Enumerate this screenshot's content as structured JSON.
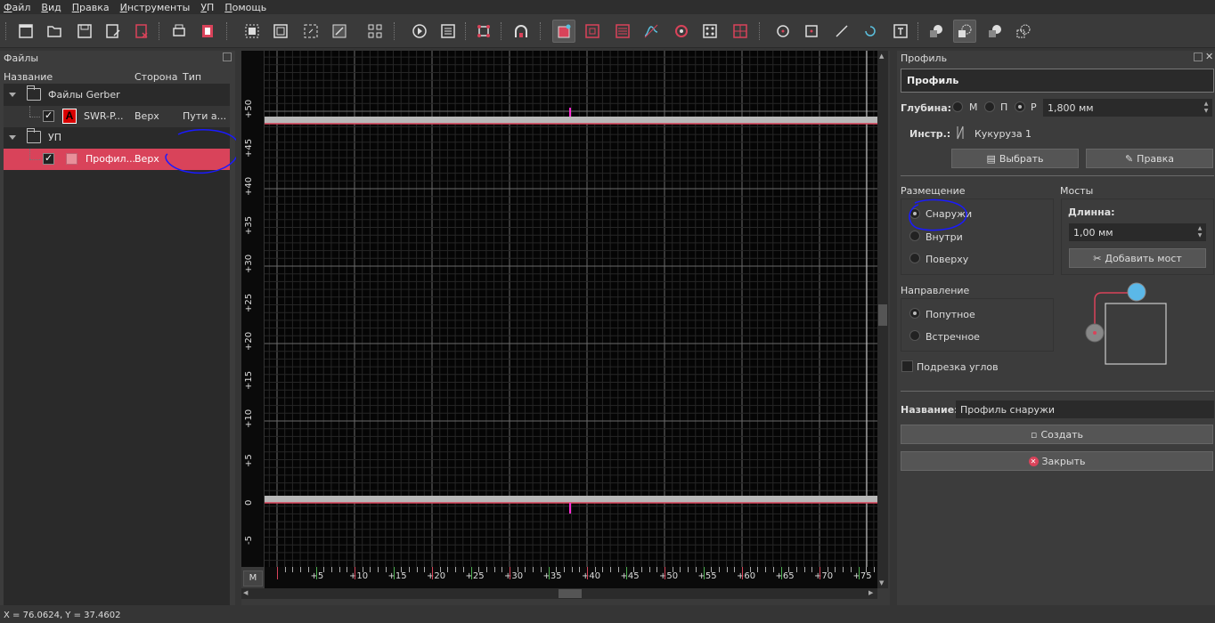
{
  "menu": [
    "Файл",
    "Вид",
    "Правка",
    "Инструменты",
    "УП",
    "Помощь"
  ],
  "menu_underline": [
    "Ф",
    "В",
    "П",
    "И",
    "У",
    "П"
  ],
  "menu_rest": [
    "айл",
    "ид",
    "равка",
    "нструменты",
    "П",
    "омощь"
  ],
  "files_panel": {
    "title": "Файлы",
    "columns": [
      "Название",
      "Сторона",
      "Тип"
    ],
    "rows": [
      {
        "name": "Файлы Gerber"
      },
      {
        "name": "SWR-P...",
        "side": "Верх",
        "type": "Пути а..."
      },
      {
        "name": "УП"
      },
      {
        "name": "Профил...",
        "side": "Верх"
      }
    ]
  },
  "ruler": {
    "v_labels": [
      "+50",
      "+45",
      "+40",
      "+35",
      "+30",
      "+25",
      "+20",
      "+15",
      "+10",
      "+5",
      "0",
      "-5"
    ],
    "h_labels": [
      "+5",
      "+10",
      "+15",
      "+20",
      "+25",
      "+30",
      "+35",
      "+40",
      "+45",
      "+50",
      "+55",
      "+60",
      "+65",
      "+70",
      "+75"
    ],
    "m_button": "M"
  },
  "status": "X = 76.0624, Y = 37.4602",
  "profile_panel": {
    "title": "Профиль",
    "header": "Профиль",
    "depth_label": "Глубина:",
    "depth_options": [
      "М",
      "П",
      "Р"
    ],
    "depth_value": "1,800 мм",
    "tool_label": "Инстр.:",
    "tool_value": "Кукуруза 1",
    "select_button": "Выбрать",
    "edit_button": "Правка",
    "placement_label": "Размещение",
    "placement_options": [
      "Снаружи",
      "Внутри",
      "Поверху"
    ],
    "bridges_label": "Мосты",
    "length_label": "Длинна:",
    "length_value": "1,00 мм",
    "add_bridge_button": "Добавить мост",
    "direction_label": "Направление",
    "direction_options": [
      "Попутное",
      "Встречное"
    ],
    "corners_label": "Подрезка углов",
    "name_label": "Название:",
    "name_value": "Профиль снаружи",
    "create_button": "Создать",
    "close_button": "Закрыть"
  }
}
